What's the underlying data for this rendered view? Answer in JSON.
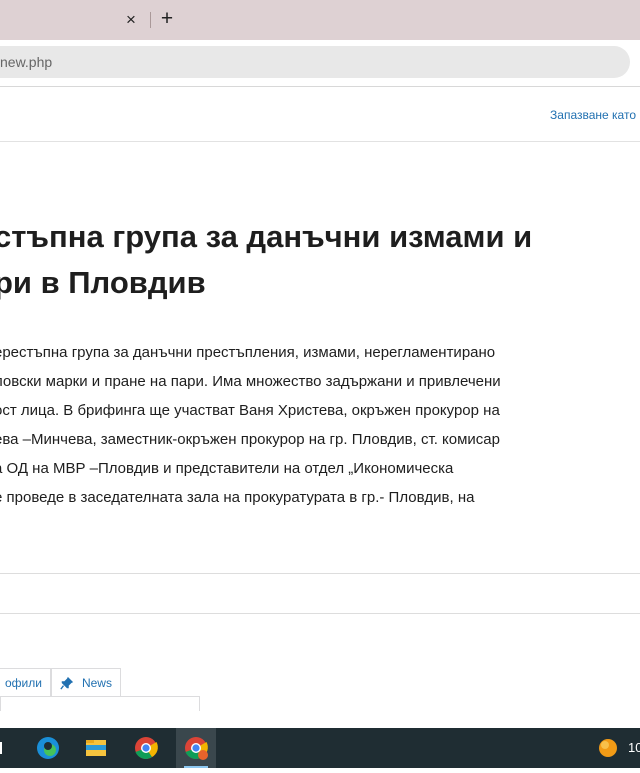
{
  "browser": {
    "tab_close_glyph": "×",
    "new_tab_glyph": "+",
    "address": "new.php"
  },
  "header": {
    "save_link": "Запазване като"
  },
  "post": {
    "title_lines": [
      "стъпна група за данъчни измами и",
      "ри в Пловдив"
    ],
    "body_lines": [
      "ерестъпна група за данъчни престъпления, измами, нерегламентирано",
      "ловски марки и пране на пари. Има множество задържани и привлечени",
      "ост лица.  В  брифинга ще участват Ваня Христева, окръжен прокурор на",
      "ева –Минчева, заместник-окръжен прокурор на гр. Пловдив, ст. комисар",
      "а ОД на МВР –Пловдив и представители на отдел „Икономическа",
      "е проведе в заседателната зала на прокуратурата в гр.- Пловдив, на"
    ]
  },
  "meta_tabs": [
    {
      "label": "офили"
    },
    {
      "label": "News",
      "icon": "pin-icon"
    }
  ],
  "taskbar": {
    "items": [
      "task-view-icon",
      "edge-icon",
      "file-explorer-icon",
      "chrome-icon",
      "chrome-profile-icon"
    ],
    "clock_text": "10",
    "tray_icon": "notification-orange-icon",
    "colors": {
      "bar": "#1f2d33",
      "accent": "#8cc7f0"
    }
  },
  "colors": {
    "tabbar": "#ded1d3",
    "link": "#2271b1",
    "text": "#1e1e1e"
  }
}
